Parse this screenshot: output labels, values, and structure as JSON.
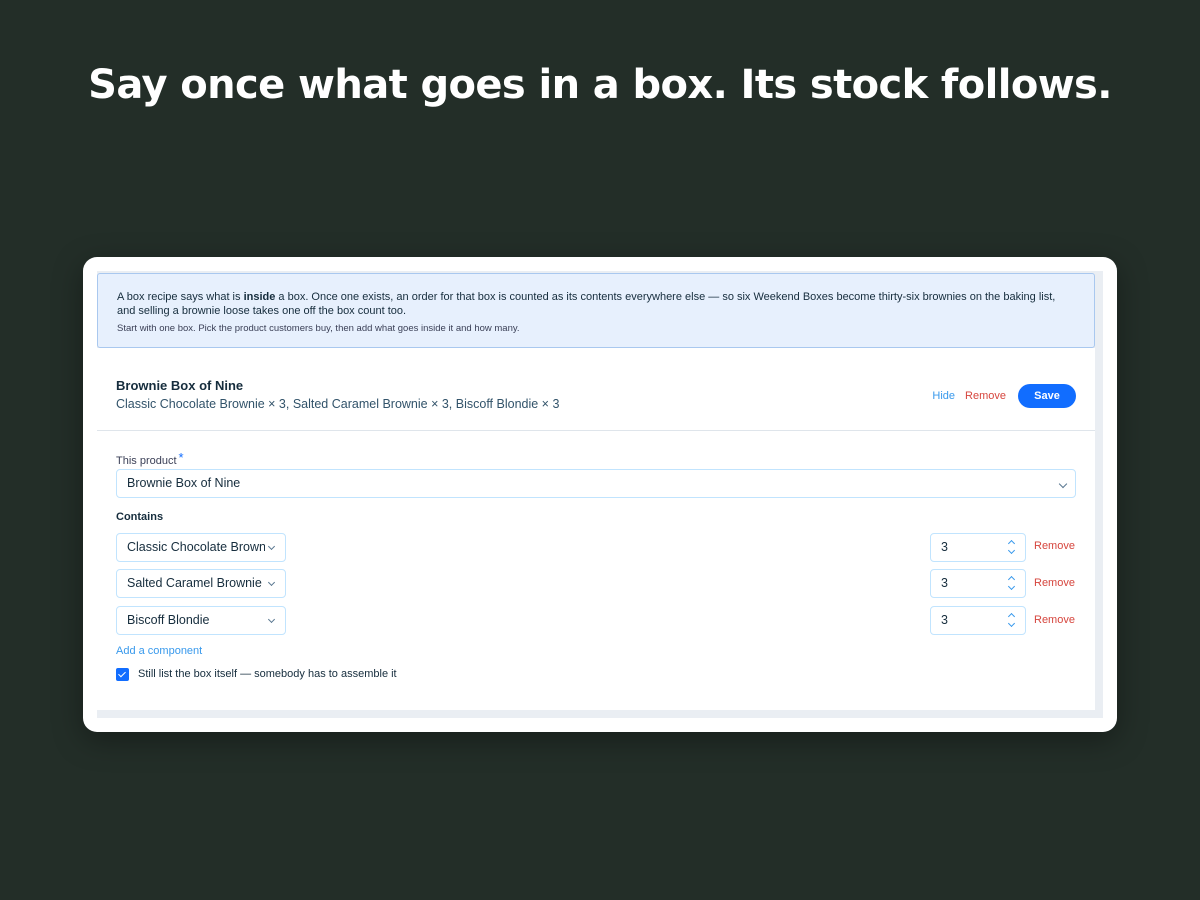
{
  "headline": "Say once what goes in a box. Its stock follows.",
  "info_banner": {
    "line1_before": "A box recipe says what is ",
    "line1_bold": "inside",
    "line1_after": " a box. Once one exists, an order for that box is counted as its contents everywhere else — so six Weekend Boxes become thirty-six brownies on the baking list, and selling a brownie loose takes one off the box count too.",
    "line2": "Start with one box. Pick the product customers buy, then add what goes inside it and how many."
  },
  "recipe": {
    "title": "Brownie Box of Nine",
    "summary": "Classic Chocolate Brownie × 3, Salted Caramel Brownie × 3, Biscoff Blondie × 3",
    "actions": {
      "hide": "Hide",
      "remove": "Remove",
      "save": "Save"
    },
    "product_label": "This product",
    "required_mark": "*",
    "product_value": "Brownie Box of Nine",
    "contains_label": "Contains",
    "components": [
      {
        "name": "Classic Chocolate Brownie",
        "qty": "3",
        "remove": "Remove"
      },
      {
        "name": "Salted Caramel Brownie",
        "qty": "3",
        "remove": "Remove"
      },
      {
        "name": "Biscoff Blondie",
        "qty": "3",
        "remove": "Remove"
      }
    ],
    "add_component": "Add a component",
    "list_box_itself": {
      "checked": true,
      "label": "Still list the box itself — somebody has to assemble it"
    }
  },
  "colors": {
    "page_bg": "#232e28",
    "accent": "#116dff",
    "link": "#3899ec",
    "danger": "#d6453d",
    "info_bg": "#e7f0fd"
  }
}
